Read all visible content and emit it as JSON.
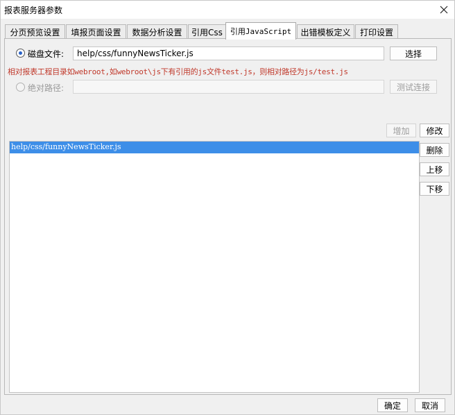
{
  "window": {
    "title": "报表服务器参数"
  },
  "tabs": [
    {
      "label": "分页预览设置",
      "active": false
    },
    {
      "label": "填报页面设置",
      "active": false
    },
    {
      "label": "数据分析设置",
      "active": false
    },
    {
      "label": "引用Css",
      "active": false
    },
    {
      "label": "引用JavaScript",
      "active": true
    },
    {
      "label": "出错模板定义",
      "active": false
    },
    {
      "label": "打印设置",
      "active": false
    }
  ],
  "disk_file": {
    "label": "磁盘文件:",
    "value": "help/css/funnyNewsTicker.js",
    "selected": true,
    "choose_button": "选择"
  },
  "hint": "相对报表工程目录如webroot,如webroot\\js下有引用的js文件test.js，则相对路径为js/test.js",
  "absolute_path": {
    "label": "绝对路径:",
    "value": "",
    "selected": false,
    "test_button": "测试连接"
  },
  "list_actions": {
    "add": "增加",
    "modify": "修改",
    "delete": "删除",
    "move_up": "上移",
    "move_down": "下移"
  },
  "file_list": [
    "help/css/funnyNewsTicker.js"
  ],
  "footer": {
    "ok": "确定",
    "cancel": "取消"
  },
  "colors": {
    "selection": "#3d8ee8",
    "hint_text": "#c0392b",
    "radio_accent": "#2a63c7"
  }
}
